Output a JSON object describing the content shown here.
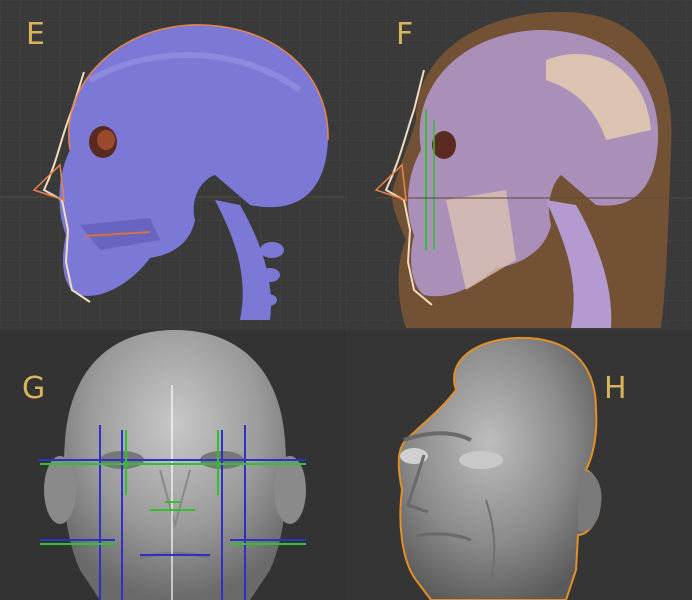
{
  "panels": [
    {
      "id": "E",
      "label": "E"
    },
    {
      "id": "F",
      "label": "F"
    },
    {
      "id": "G",
      "label": "G"
    },
    {
      "id": "H",
      "label": "H"
    }
  ],
  "colors": {
    "viewport_bg": "#3a3a3a",
    "grid_line": "#454545",
    "label": "#d9b45a",
    "skull_blue": "#7b78d6",
    "profile_orange": "#e8844a",
    "outline_cream": "#f0dcc0",
    "head_brown": "#7a5434",
    "skin_cream": "#e0c8b0",
    "sculpt_gray": "#9a9a9a",
    "guide_blue": "#3030c8",
    "guide_green": "#30c030",
    "select_orange": "#e0902a"
  },
  "icons": {
    "E": "skull-profile-image",
    "F": "skull-overlay-head-image",
    "G": "sculpt-front-head-image",
    "H": "sculpt-three-quarter-head-image"
  }
}
